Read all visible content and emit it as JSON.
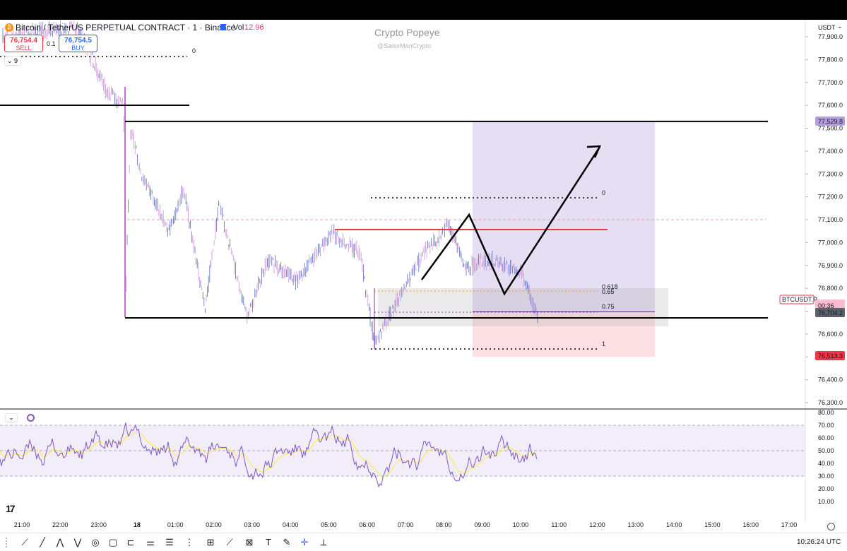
{
  "header": {
    "symbol_title": "Bitcoin / TetherUS PERPETUAL CONTRACT · 1 · Binance",
    "vol_label": "Vol",
    "vol_value": "12.96",
    "sell_price": "76,754.4",
    "sell_label": "SELL",
    "spread": "0.1",
    "buy_price": "76,754.5",
    "buy_label": "BUY",
    "indicator_count": "9",
    "watermark_title": "Crypto Popeye",
    "watermark_handle": "@SailorManCrypto",
    "currency": "USDT"
  },
  "price_axis": {
    "ticks": [
      "77,900.0",
      "77,800.0",
      "77,700.0",
      "77,600.0",
      "77,500.0",
      "77,400.0",
      "77,300.0",
      "77,200.0",
      "77,100.0",
      "77,000.0",
      "76,900.0",
      "76,800.0",
      "76,700.0",
      "76,600.0",
      "76,500.0",
      "76,400.0",
      "76,300.0"
    ],
    "ticker_label": "BTCUSDT.P",
    "last_price": "76,754.5",
    "countdown": "00:36",
    "label_top": "77,529.8",
    "label_mid": "76,704.2",
    "label_bottom": "76,513.3",
    "colors": {
      "purple": "#b39ddb",
      "red": "#f23645",
      "gray": "#5d606b",
      "pink": "#f7c8cc"
    }
  },
  "rsi_axis": {
    "ticks": [
      "80.00",
      "70.00",
      "60.00",
      "50.00",
      "40.00",
      "30.00",
      "20.00",
      "10.00"
    ]
  },
  "time_axis": {
    "ticks": [
      "21:00",
      "22:00",
      "23:00",
      "18",
      "01:00",
      "02:00",
      "03:00",
      "04:00",
      "05:00",
      "06:00",
      "07:00",
      "08:00",
      "09:00",
      "10:00",
      "11:00",
      "12:00",
      "13:00",
      "14:00",
      "15:00",
      "16:00",
      "17:00"
    ],
    "clock": "10:26:24 UTC"
  },
  "fib_levels": {
    "top_left": "0",
    "upper_zero": "0",
    "level_618": "0.618",
    "level_65": "0.65",
    "level_75": "0.75",
    "level_1": "1"
  },
  "chart_data": {
    "type": "candlestick",
    "title": "Bitcoin / TetherUS PERPETUAL CONTRACT · 1 · Binance",
    "ylim": [
      76250,
      77950
    ],
    "x_range": [
      "21:00",
      "17:00"
    ],
    "key_levels": [
      77529.8,
      76704.2,
      77600,
      76513.3
    ],
    "last_price": 76754.5,
    "rsi_ylim": [
      10,
      80
    ],
    "rsi_bands": [
      70,
      30
    ]
  },
  "toolbar": {
    "tools": [
      "crosshair-icon",
      "trendline-icon",
      "pitchfork-icon",
      "pattern-icon",
      "brush-icon",
      "shapes-icon",
      "rectangle-icon",
      "measure-icon",
      "fib-icon",
      "elliott-icon",
      "projection-icon",
      "gann-icon",
      "forecast-icon",
      "text-icon",
      "marker-icon",
      "magnet-icon",
      "ruler-icon"
    ]
  }
}
